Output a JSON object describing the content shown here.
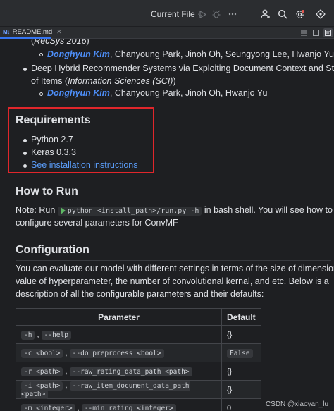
{
  "toolbar": {
    "run_config": "Current File",
    "icons": [
      "run-icon",
      "debug-icon",
      "add-user-icon",
      "search-icon",
      "settings-icon"
    ]
  },
  "tab": {
    "badge": "M↓",
    "label": "README.md"
  },
  "readme": {
    "papers": [
      {
        "venue_tail": "RecSys 2016",
        "first_author": "Donghyun Kim",
        "coauthors": ", Chanyoung Park, Jinoh Oh, Seungyong Lee, Hwanjo Yu"
      },
      {
        "title_line1": "Deep Hybrid Recommender Systems via Exploiting Document Context and Statistics",
        "title_line2_prefix": "of Items (",
        "venue": "Information Sciences (SCI)",
        "title_line2_suffix": ")",
        "first_author": "Donghyun Kim",
        "coauthors": ", Chanyoung Park, Jinoh Oh, Hwanjo Yu"
      }
    ],
    "requirements": {
      "heading": "Requirements",
      "items": [
        "Python 2.7",
        "Keras 0.3.3"
      ],
      "link": "See installation instructions"
    },
    "how_to_run": {
      "heading": "How to Run",
      "note_prefix": "Note: Run",
      "command": "python <install_path>/run.py -h",
      "note_suffix": "in bash shell. You will see how to",
      "note_line2": "configure several parameters for ConvMF"
    },
    "configuration": {
      "heading": "Configuration",
      "lines": [
        "You can evaluate our model with different settings in terms of the size of dimension, the",
        "value of hyperparameter, the number of convolutional kernal, and etc. Below is a",
        "description of all the configurable parameters and their defaults:"
      ],
      "table": {
        "headers": [
          "Parameter",
          "Default"
        ],
        "rows": [
          {
            "params": [
              "-h",
              "--help"
            ],
            "default": "{}",
            "default_code": false
          },
          {
            "params": [
              "-c <bool>",
              "--do_preprocess <bool>"
            ],
            "default": "False",
            "default_code": true
          },
          {
            "params": [
              "-r <path>",
              "--raw_rating_data_path <path>"
            ],
            "default": "{}",
            "default_code": false
          },
          {
            "params": [
              "-i <path>",
              "--raw_item_document_data_path <path>"
            ],
            "default": "{}",
            "default_code": false
          },
          {
            "params": [
              "-m <integer>",
              "--min_rating <integer>"
            ],
            "default": "0",
            "default_code": false
          }
        ]
      }
    }
  },
  "watermark": "CSDN @xiaoyan_lu",
  "colors": {
    "background": "#1e1f22",
    "link": "#5a9cf8",
    "author": "#4d8ef8",
    "highlight_box": "#e0262b"
  }
}
